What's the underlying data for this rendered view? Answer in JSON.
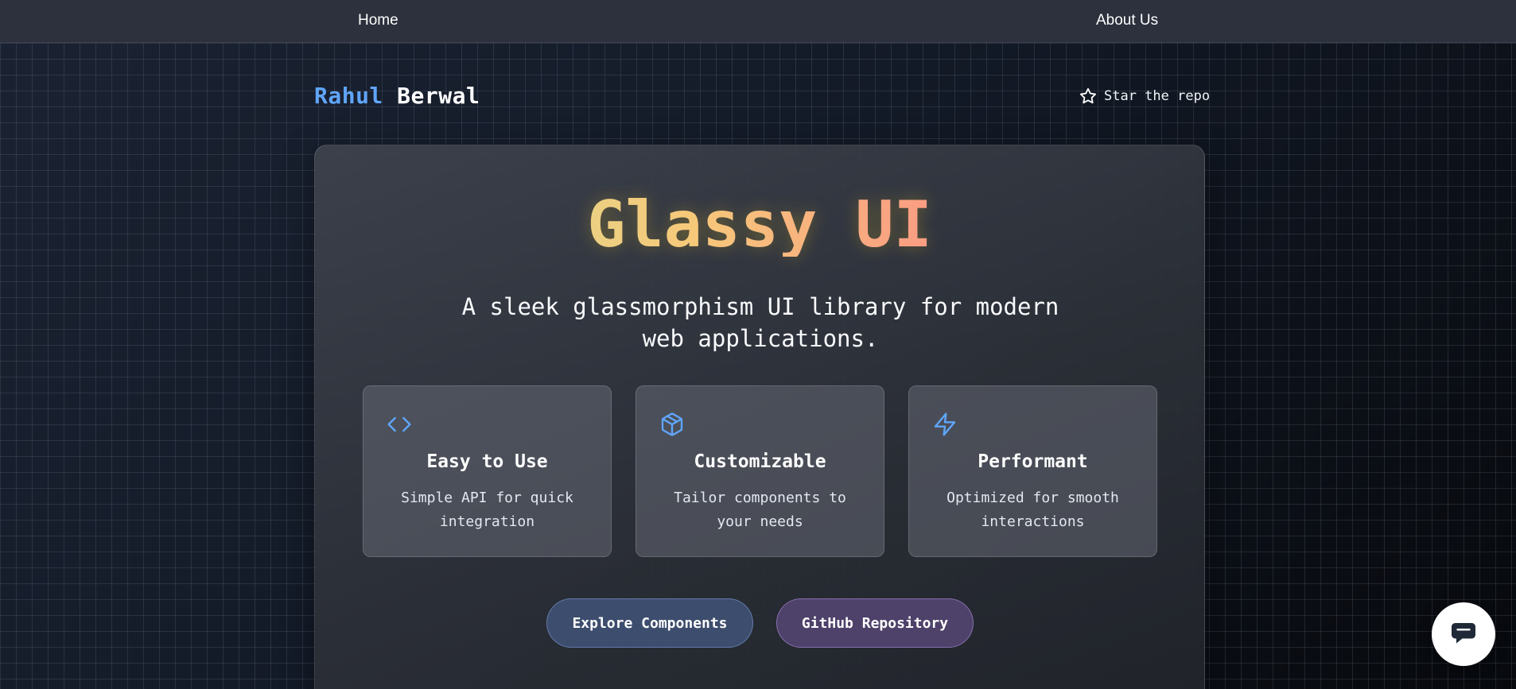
{
  "nav": {
    "home_label": "Home",
    "about_label": "About Us"
  },
  "brand": {
    "first_name": "Rahul",
    "last_name": "Berwal",
    "first_color": "#60a5fa"
  },
  "star_repo": {
    "label": "Star the repo",
    "icon": "star-icon"
  },
  "hero": {
    "title": "Glassy UI",
    "subtitle": "A sleek glassmorphism UI library for modern web applications."
  },
  "features": [
    {
      "icon": "code-icon",
      "title": "Easy to Use",
      "description": "Simple API for quick integration"
    },
    {
      "icon": "box-icon",
      "title": "Customizable",
      "description": "Tailor components to your needs"
    },
    {
      "icon": "zap-icon",
      "title": "Performant",
      "description": "Optimized for smooth interactions"
    }
  ],
  "buttons": {
    "explore_label": "Explore Components",
    "github_label": "GitHub Repository"
  },
  "chat": {
    "icon": "chat-bubble-icon"
  },
  "colors": {
    "accent_blue": "#60a5fa",
    "title_gradient": [
      "#cfe39b",
      "#f6c97a",
      "#fb8e86",
      "#f87171"
    ]
  }
}
